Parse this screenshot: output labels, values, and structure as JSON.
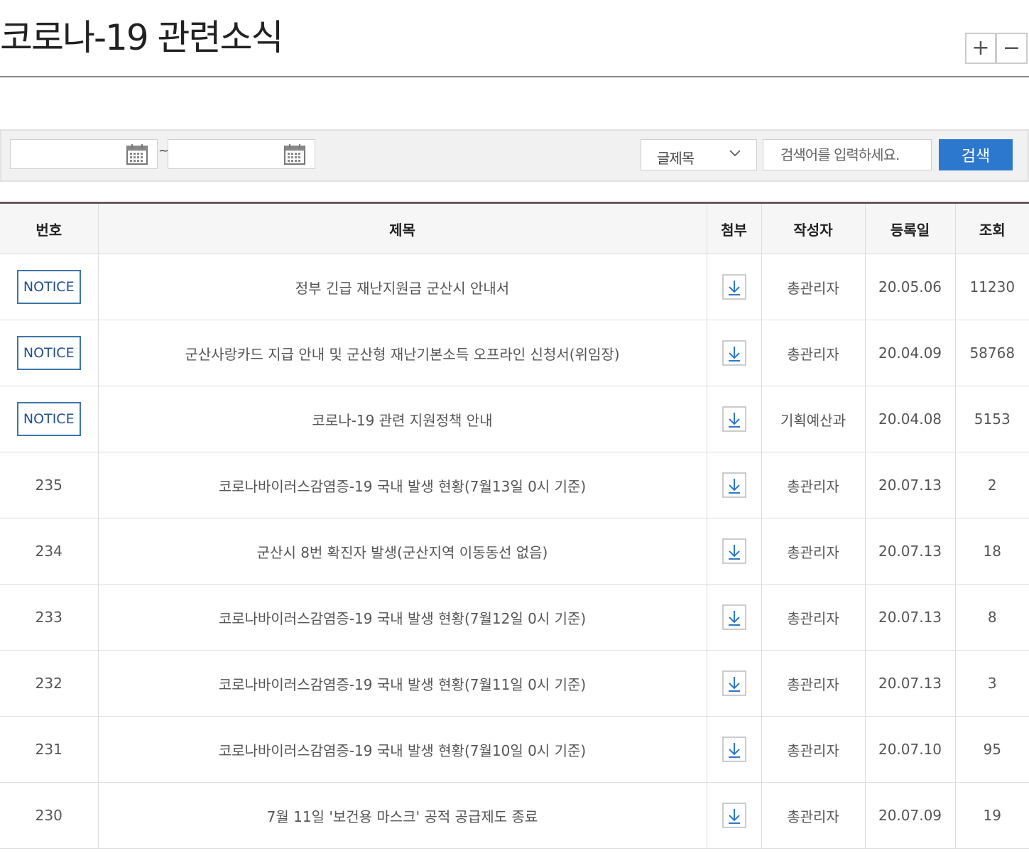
{
  "page": {
    "title": "코로나-19 관련소식"
  },
  "font_size": {
    "increase_label": "+",
    "decrease_label": "−"
  },
  "search": {
    "date_from": "",
    "date_to": "",
    "range_separator": "~",
    "field_selected": "글제목",
    "placeholder": "검색어를 입력하세요.",
    "button_label": "검색"
  },
  "table": {
    "headers": [
      "번호",
      "제목",
      "첨부",
      "작성자",
      "등록일",
      "조회"
    ],
    "rows": [
      {
        "no": "NOTICE",
        "title": "정부 긴급 재난지원금 군산시 안내서",
        "author": "총관리자",
        "date": "20.05.06",
        "views": "11230"
      },
      {
        "no": "NOTICE",
        "title": "군산사랑카드 지급 안내 및 군산형 재난기본소득 오프라인 신청서(위임장)",
        "author": "총관리자",
        "date": "20.04.09",
        "views": "58768"
      },
      {
        "no": "NOTICE",
        "title": "코로나-19 관련 지원정책 안내",
        "author": "기획예산과",
        "date": "20.04.08",
        "views": "5153"
      },
      {
        "no": "235",
        "title": "코로나바이러스감염증-19 국내 발생 현황(7월13일 0시 기준)",
        "author": "총관리자",
        "date": "20.07.13",
        "views": "2"
      },
      {
        "no": "234",
        "title": "군산시 8번 확진자 발생(군산지역 이동동선 없음)",
        "author": "총관리자",
        "date": "20.07.13",
        "views": "18"
      },
      {
        "no": "233",
        "title": "코로나바이러스감염증-19 국내 발생 현황(7월12일 0시 기준)",
        "author": "총관리자",
        "date": "20.07.13",
        "views": "8"
      },
      {
        "no": "232",
        "title": "코로나바이러스감염증-19 국내 발생 현황(7월11일 0시 기준)",
        "author": "총관리자",
        "date": "20.07.13",
        "views": "3"
      },
      {
        "no": "231",
        "title": "코로나바이러스감염증-19 국내 발생 현황(7월10일 0시 기준)",
        "author": "총관리자",
        "date": "20.07.10",
        "views": "95"
      },
      {
        "no": "230",
        "title": "7월 11일 '보건용 마스크' 공적 공급제도 종료",
        "author": "총관리자",
        "date": "20.07.09",
        "views": "19"
      }
    ]
  },
  "colors": {
    "accent": "#2d78cf",
    "notice_border": "#3e76a8",
    "table_top_rule": "#6b5a5f"
  },
  "icons": {
    "calendar": "calendar-icon",
    "download": "download-icon",
    "select": "chevron-down-icon"
  }
}
